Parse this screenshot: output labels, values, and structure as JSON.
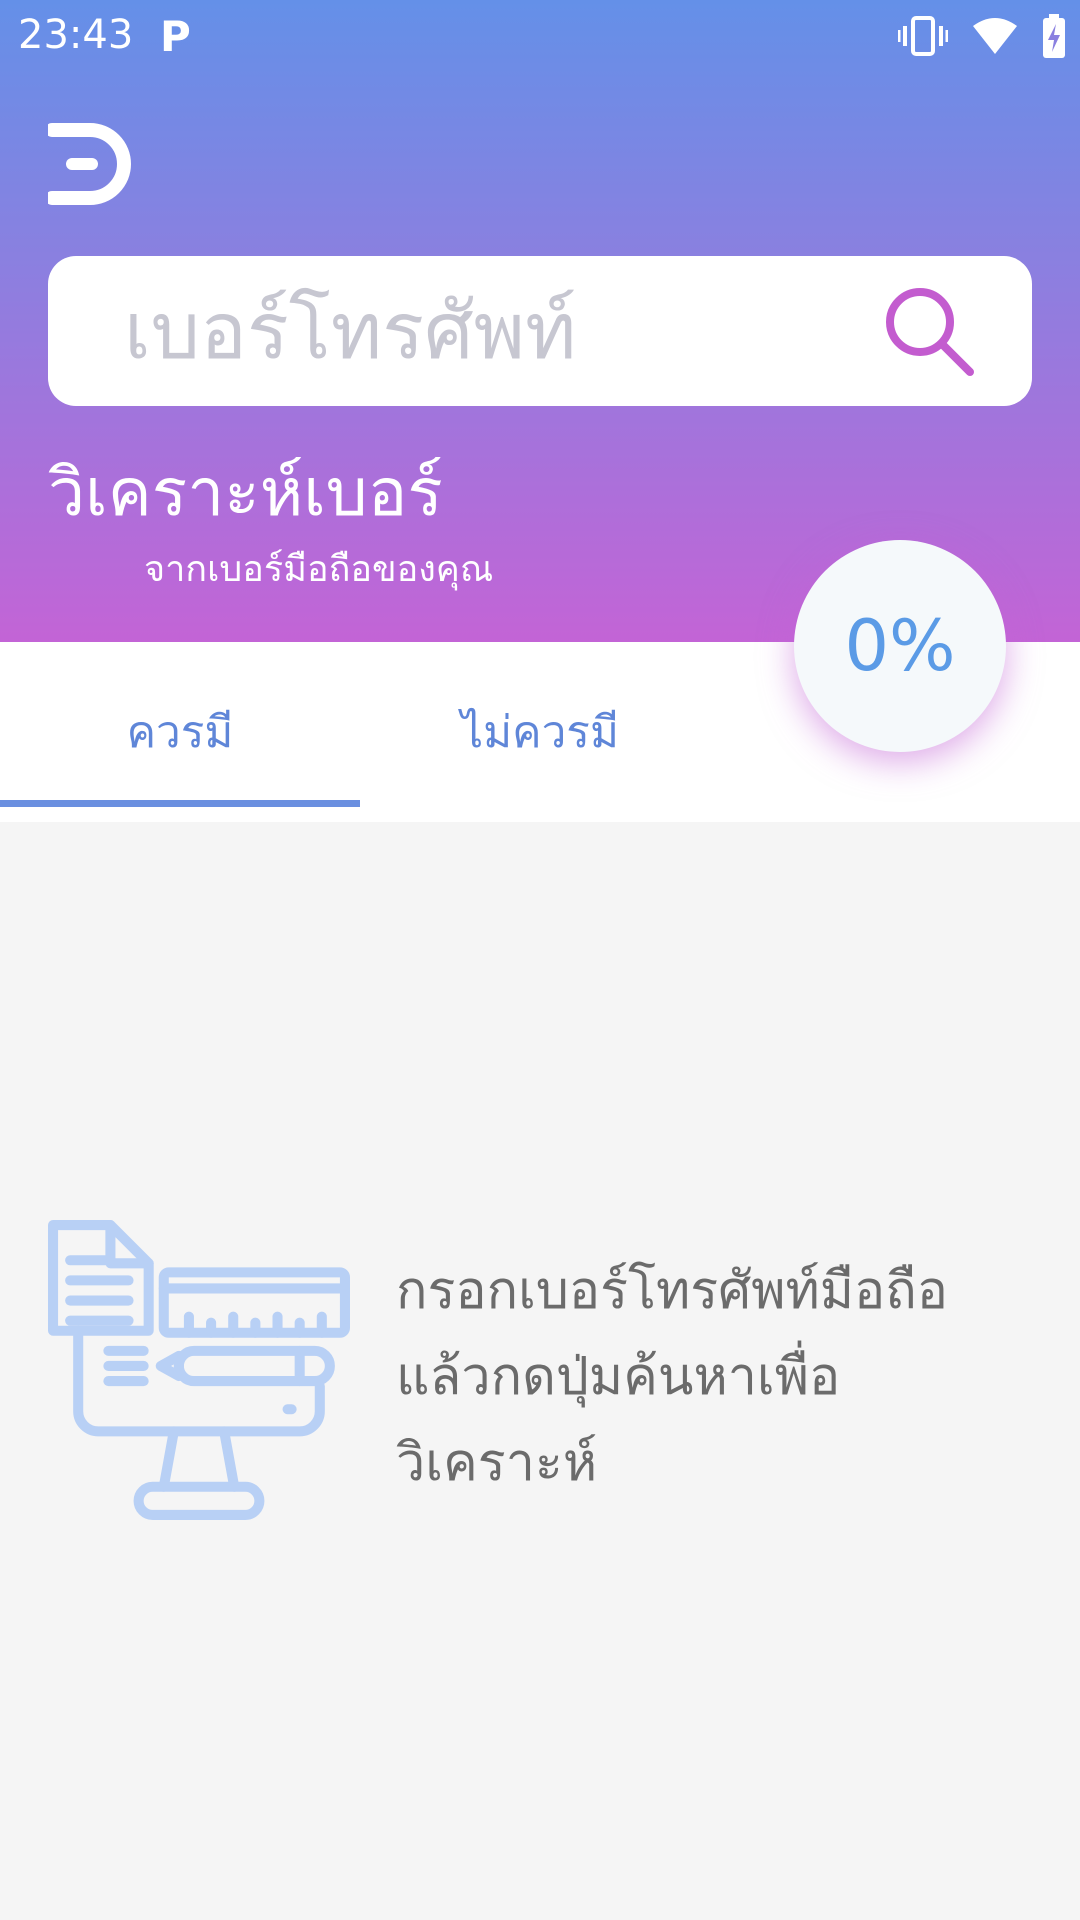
{
  "status_bar": {
    "time": "23:43",
    "notification_icon": "p-icon",
    "icons": [
      "vibrate-icon",
      "wifi-icon",
      "battery-charging-icon"
    ]
  },
  "header": {
    "logo": "app-logo",
    "search": {
      "placeholder": "เบอร์โทรศัพท์",
      "value": "",
      "button_icon": "search-icon"
    },
    "title": "วิเคราะห์เบอร์",
    "subtitle": "จากเบอร์มือถือของคุณ"
  },
  "score": {
    "value": "0%"
  },
  "tabs": [
    {
      "label": "ควรมี",
      "selected": true
    },
    {
      "label": "ไม่ควรมี",
      "selected": false
    }
  ],
  "empty_state": {
    "icon": "document-computer-illustration-icon",
    "message": "กรอกเบอร์โทรศัพท์มือถือแล้วกดปุ่มค้นหาเพื่อวิเคราะห์"
  },
  "colors": {
    "gradient_top": "#6490e8",
    "gradient_bottom": "#c364d6",
    "tab_accent": "#6a8fe0",
    "percent_text": "#5b9be6",
    "search_icon": "#c35ccf",
    "illustration": "#b8d0f5"
  }
}
